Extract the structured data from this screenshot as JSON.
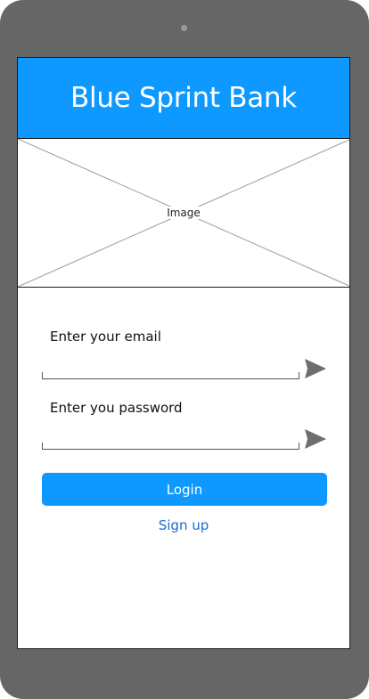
{
  "app": {
    "title": "Blue Sprint Bank"
  },
  "image_placeholder": {
    "label": "Image"
  },
  "form": {
    "email_label": "Enter your email",
    "email_value": "",
    "password_label": "Enter you password",
    "password_value": "",
    "login_label": "Login",
    "signup_label": "Sign up"
  },
  "icons": {
    "email_send": "send-icon",
    "password_send": "send-icon"
  },
  "colors": {
    "primary": "#0d99ff",
    "link": "#1a6fd1",
    "device": "#666666"
  }
}
